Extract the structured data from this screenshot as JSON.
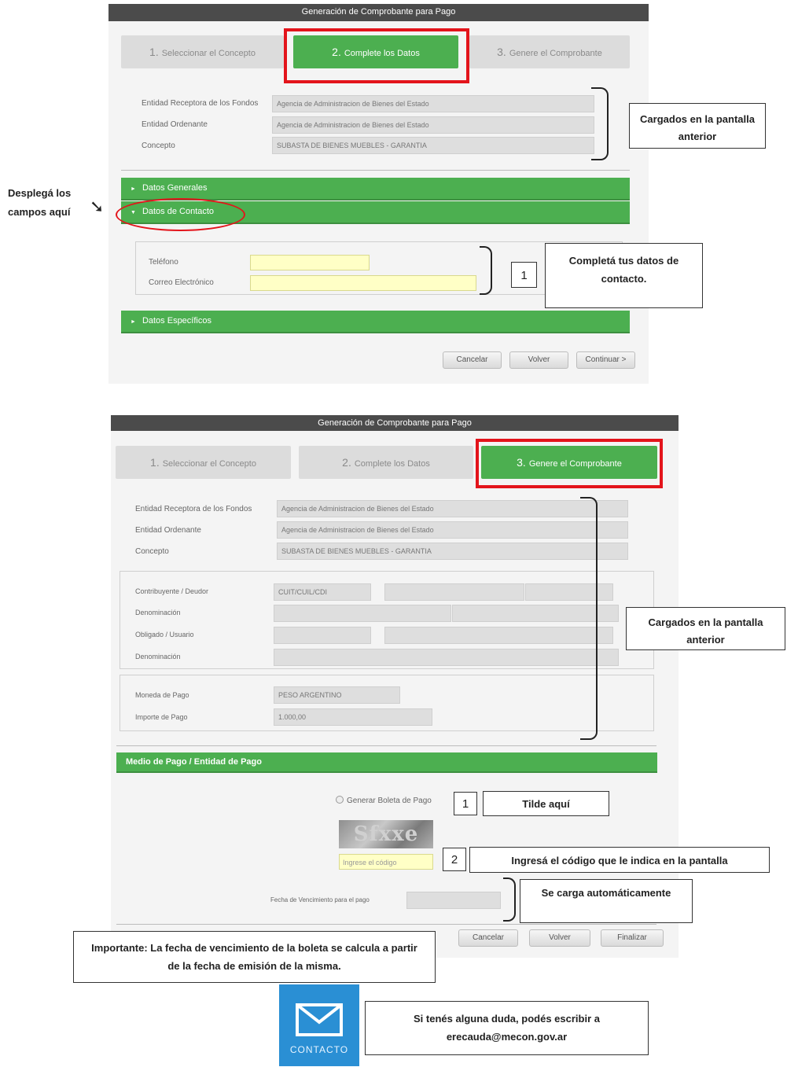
{
  "screen1": {
    "title": "Generación de Comprobante para Pago",
    "steps": [
      {
        "num": "1.",
        "label": "Seleccionar el Concepto"
      },
      {
        "num": "2.",
        "label": "Complete los Datos"
      },
      {
        "num": "3.",
        "label": "Genere el Comprobante"
      }
    ],
    "fields": [
      {
        "label": "Entidad Receptora de los Fondos",
        "value": "Agencia de Administracion de Bienes del Estado"
      },
      {
        "label": "Entidad Ordenante",
        "value": "Agencia de Administracion de Bienes del Estado"
      },
      {
        "label": "Concepto",
        "value": "SUBASTA DE BIENES MUEBLES - GARANTIA"
      }
    ],
    "sections": {
      "generales": "Datos Generales",
      "contacto": "Datos de Contacto",
      "especificos": "Datos Específicos"
    },
    "contact": {
      "telefono_label": "Teléfono",
      "correo_label": "Correo Electrónico",
      "telefono_value": "",
      "correo_value": ""
    },
    "buttons": {
      "cancel": "Cancelar",
      "back": "Volver",
      "next": "Continuar >"
    },
    "callouts": {
      "loaded": "Cargados en la pantalla anterior",
      "expand": "Desplegá los campos aquí",
      "number": "1",
      "contact": "Completá tus datos de contacto."
    }
  },
  "screen2": {
    "title": "Generación de Comprobante para Pago",
    "steps": [
      {
        "num": "1.",
        "label": "Seleccionar el Concepto"
      },
      {
        "num": "2.",
        "label": "Complete los Datos"
      },
      {
        "num": "3.",
        "label": "Genere el Comprobante"
      }
    ],
    "fields": [
      {
        "label": "Entidad Receptora de los Fondos",
        "value": "Agencia de Administracion de Bienes del Estado"
      },
      {
        "label": "Entidad Ordenante",
        "value": "Agencia de Administracion de Bienes del Estado"
      },
      {
        "label": "Concepto",
        "value": "SUBASTA DE BIENES MUEBLES - GARANTIA"
      }
    ],
    "contrib": {
      "contribuyente_label": "Contribuyente / Deudor",
      "cuit_value": "CUIT/CUIL/CDI",
      "denominacion_label": "Denominación",
      "obligado_label": "Obligado / Usuario",
      "denominacion2_label": "Denominación"
    },
    "payment": {
      "moneda_label": "Moneda de Pago",
      "moneda_value": "PESO ARGENTINO",
      "importe_label": "Importe de Pago",
      "importe_value": "1.000,00"
    },
    "medio_title": "Medio de Pago / Entidad de Pago",
    "radio_label": "Generar Boleta de Pago",
    "captcha_text": "Sfxxe",
    "captcha_placeholder": "Ingrese el código",
    "vencimiento_label": "Fecha de Vencimiento para el pago",
    "buttons": {
      "cancel": "Cancelar",
      "back": "Volver",
      "finish": "Finalizar"
    },
    "callouts": {
      "loaded": "Cargados en la pantalla anterior",
      "num1": "1",
      "tilde": "Tilde aquí",
      "num2": "2",
      "codigo": "Ingresá el código que le indica en la pantalla",
      "auto": "Se carga automáticamente",
      "importante": "Importante: La fecha de vencimiento de la boleta se calcula a partir de la fecha de emisión de la misma."
    }
  },
  "contact_footer": {
    "badge_label": "CONTACTO",
    "message": "Si tenés alguna duda, podés escribir a erecauda@mecon.gov.ar"
  },
  "colors": {
    "green": "#4caf50",
    "red": "#e3141b",
    "yellow": "#ffffc6"
  }
}
